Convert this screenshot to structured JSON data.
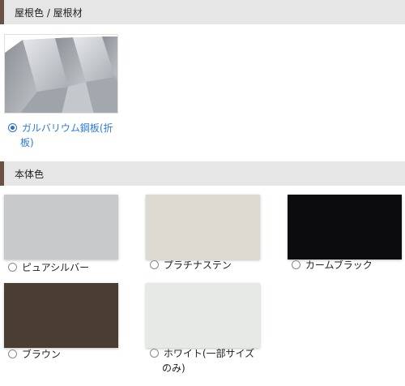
{
  "roof_section": {
    "title": "屋根色 / 屋根材",
    "option": {
      "label_line1": "ガルバリウム鋼板(折",
      "label_line2": "板)",
      "selected": true,
      "image_icon": "corrugated-metal-sheet"
    }
  },
  "body_section": {
    "title": "本体色",
    "colors": [
      {
        "label": "ピュアシルバー",
        "color": "#c8c9cb"
      },
      {
        "label": "プラチナステン",
        "color": "#dddbd1"
      },
      {
        "label": "カームブラック",
        "color": "#0c0b0e"
      },
      {
        "label": "ブラウン",
        "color": "#4a3d31"
      },
      {
        "label_line1": "ホワイト(一部サイズ",
        "label_line2": "のみ)",
        "color": "#e6e9e5"
      }
    ]
  },
  "accent_color": "#6b5045",
  "selected_color": "#2c7bd6"
}
